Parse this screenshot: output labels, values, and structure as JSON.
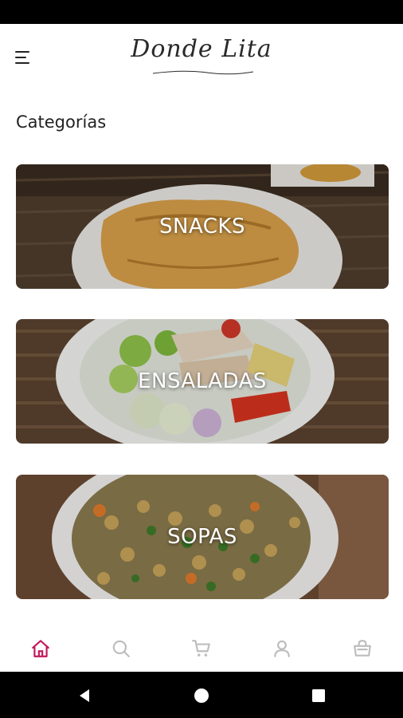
{
  "app": {
    "logo_text": "Donde Lita"
  },
  "header": {
    "section_title": "Categorías"
  },
  "categories": [
    {
      "label": "SNACKS"
    },
    {
      "label": "ENSALADAS"
    },
    {
      "label": "SOPAS"
    }
  ],
  "bottom_nav": {
    "items": [
      {
        "icon": "home-icon",
        "active": true
      },
      {
        "icon": "search-icon",
        "active": false
      },
      {
        "icon": "cart-icon",
        "active": false
      },
      {
        "icon": "user-icon",
        "active": false
      },
      {
        "icon": "basket-icon",
        "active": false
      }
    ],
    "active_color": "#c2185b",
    "inactive_color": "#bdbdbd"
  },
  "system_nav": [
    "back-icon",
    "home-circle-icon",
    "recents-icon"
  ]
}
